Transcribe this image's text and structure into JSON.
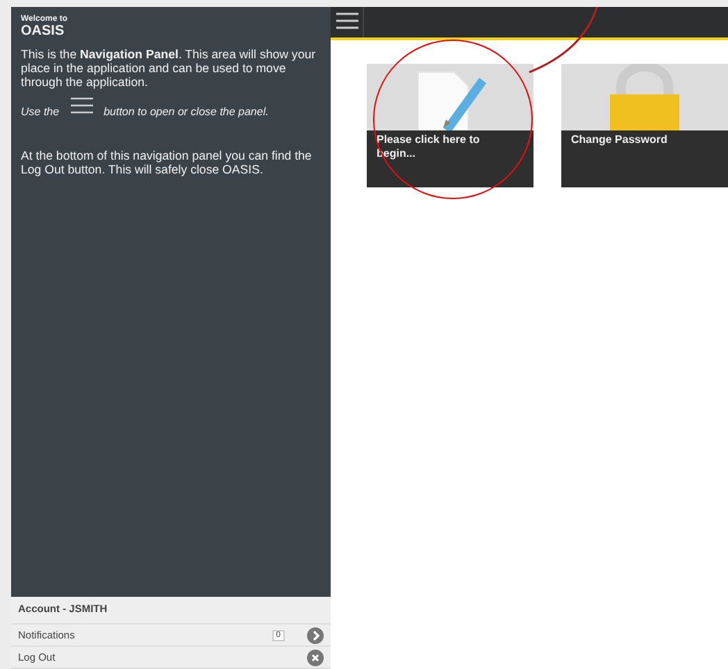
{
  "nav_panel": {
    "welcome": "Welcome to",
    "title": "OASIS",
    "intro": "This is the **Navigation Panel**. This area will show your place in the application and can be used to move through the application.",
    "hint_before": "Use the",
    "hint_after": "button to open or close the panel.",
    "footer_note": "At the bottom of this navigation panel you can find the Log Out button. This will safely close OASIS."
  },
  "account": {
    "label": "Account - JSMITH"
  },
  "menu": [
    {
      "kind": "count",
      "label": "Notifications",
      "badge": "0"
    },
    {
      "kind": "close",
      "label": "Log Out"
    }
  ],
  "tiles": [
    {
      "kind": "document",
      "caption": "Please click here to begin..."
    },
    {
      "kind": "lock",
      "caption": "Change Password"
    }
  ]
}
